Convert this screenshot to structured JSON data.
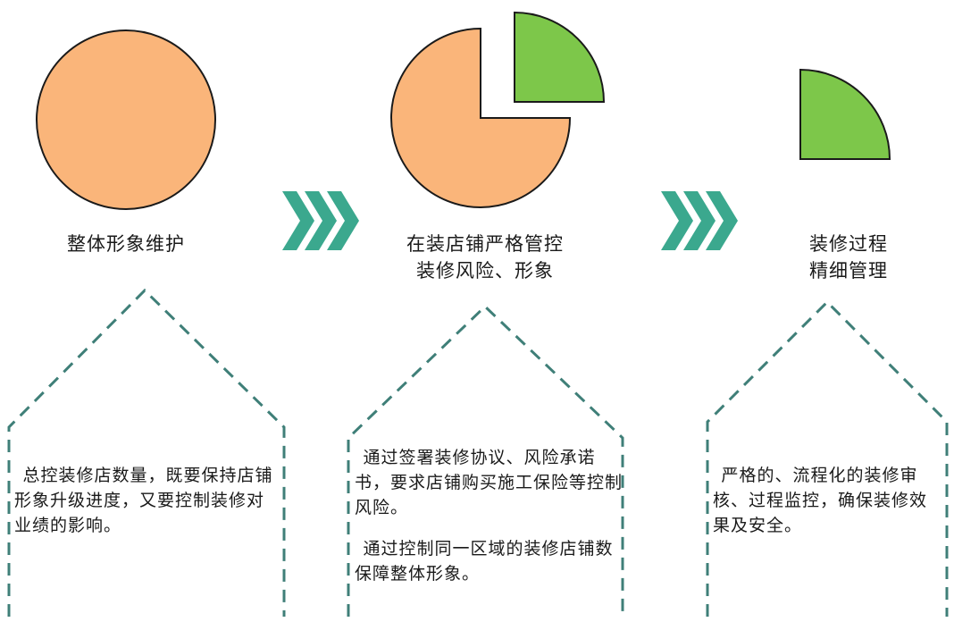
{
  "colors": {
    "orange": "#FAB57A",
    "green": "#7DC74A",
    "teal": "#3BA88E",
    "dash": "#3F7F78"
  },
  "columns": [
    {
      "label_lines": [
        "整体形象维护"
      ],
      "body": [
        "总控装修店数量，既要保持店铺形象升级进度，又要控制装修对业绩的影响。"
      ]
    },
    {
      "label_lines": [
        "在装店铺严格管控",
        "装修风险、形象"
      ],
      "body": [
        "通过签署装修协议、风险承诺书，要求店铺购买施工保险等控制风险。",
        "通过控制同一区域的装修店铺数保障整体形象。"
      ]
    },
    {
      "label_lines": [
        "装修过程",
        "精细管理"
      ],
      "body": [
        "严格的、流程化的装修审核、过程监控，确保装修效果及安全。"
      ]
    }
  ]
}
